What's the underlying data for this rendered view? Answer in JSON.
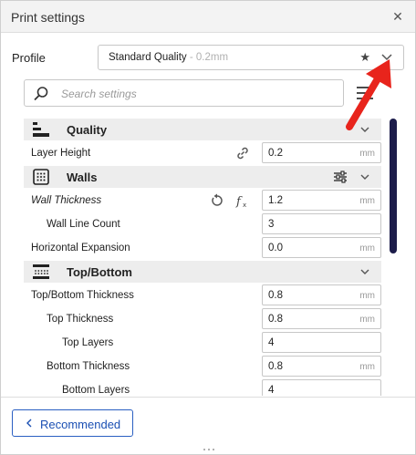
{
  "window": {
    "title": "Print settings",
    "close_icon": "close-icon"
  },
  "profile": {
    "label": "Profile",
    "selected_name": "Standard Quality",
    "selected_sub": " - 0.2mm",
    "star_icon": "star-icon",
    "chevron_icon": "chevron-down-icon"
  },
  "search": {
    "placeholder": "Search settings",
    "value": ""
  },
  "categories": {
    "quality": {
      "label": "Quality"
    },
    "walls": {
      "label": "Walls"
    },
    "topbottom": {
      "label": "Top/Bottom"
    }
  },
  "settings": {
    "layer_height": {
      "label": "Layer Height",
      "value": "0.2",
      "unit": "mm"
    },
    "wall_thickness": {
      "label": "Wall Thickness",
      "value": "1.2",
      "unit": "mm"
    },
    "wall_line_count": {
      "label": "Wall Line Count",
      "value": "3",
      "unit": ""
    },
    "horizontal_expansion": {
      "label": "Horizontal Expansion",
      "value": "0.0",
      "unit": "mm"
    },
    "topbottom_thickness": {
      "label": "Top/Bottom Thickness",
      "value": "0.8",
      "unit": "mm"
    },
    "top_thickness": {
      "label": "Top Thickness",
      "value": "0.8",
      "unit": "mm"
    },
    "top_layers": {
      "label": "Top Layers",
      "value": "4",
      "unit": ""
    },
    "bottom_thickness": {
      "label": "Bottom Thickness",
      "value": "0.8",
      "unit": "mm"
    },
    "bottom_layers": {
      "label": "Bottom Layers",
      "value": "4",
      "unit": ""
    }
  },
  "footer": {
    "recommended_label": "Recommended"
  },
  "colors": {
    "accent": "#2a5fc2",
    "scrollbar": "#1c1c4a",
    "annotation": "#e8241c",
    "category_bg": "#ededed"
  }
}
